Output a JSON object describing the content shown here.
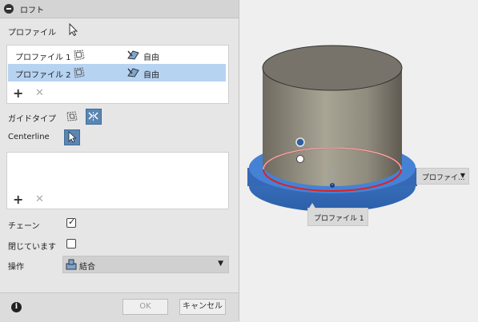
{
  "panel": {
    "title": "ロフト",
    "profile_label": "プロファイル",
    "profiles": [
      {
        "name": "プロファイル 1",
        "condition": "自由",
        "selected": false
      },
      {
        "name": "プロファイル 2",
        "condition": "自由",
        "selected": true
      }
    ],
    "guide_type_label": "ガイドタイプ",
    "centerline_label": "Centerline",
    "chain_label": "チェーン",
    "chain_checked": true,
    "closed_label": "閉じています",
    "closed_checked": false,
    "operation_label": "操作",
    "operation_value": "結合"
  },
  "footer": {
    "ok_label": "OK",
    "cancel_label": "キャンセル"
  },
  "viewport": {
    "profile_dropdown_label": "プロファイ...",
    "profile_tooltip": "プロファイル 1"
  },
  "colors": {
    "selection": "#b7d3f2",
    "active_button": "#5b86b3",
    "highlight_blue": "#3b78d4",
    "profile_red": "#e02020"
  }
}
